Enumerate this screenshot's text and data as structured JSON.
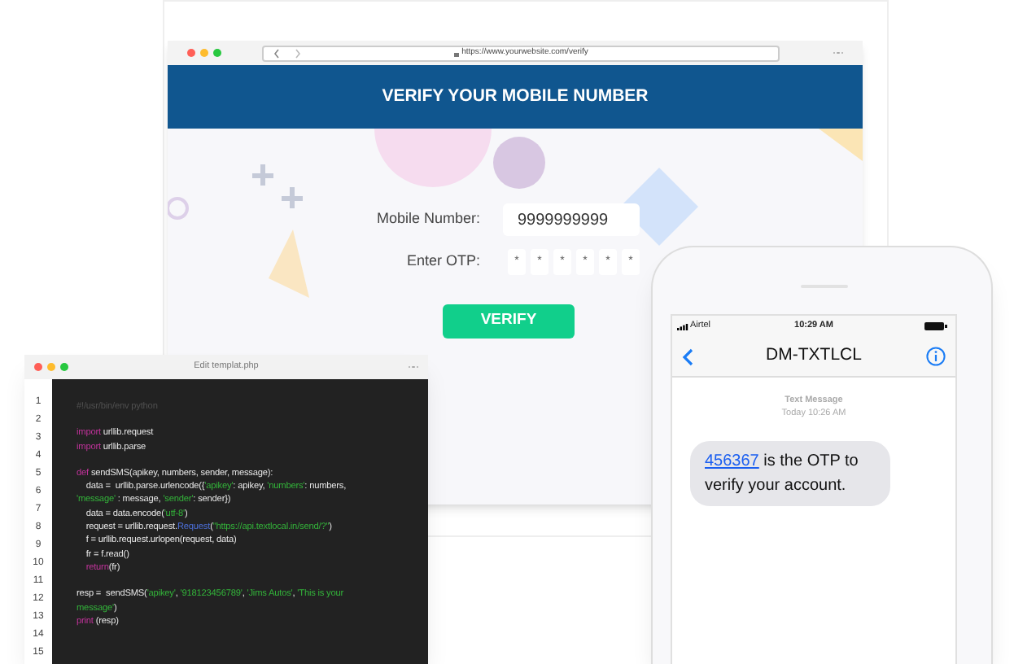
{
  "browser": {
    "url": "https://www.yourwebsite.com/verify",
    "header": "VERIFY YOUR MOBILE NUMBER",
    "form": {
      "mobile_label": "Mobile Number:",
      "mobile_value": "9999999999",
      "otp_label": "Enter OTP:",
      "otp_digits": [
        "*",
        "*",
        "*",
        "*",
        "*",
        "*"
      ],
      "button": "VERIFY"
    }
  },
  "editor": {
    "title": "Edit templat.php",
    "line_numbers": [
      "1",
      "2",
      "3",
      "4",
      "5",
      "6",
      "7",
      "8",
      "9",
      "10",
      "11",
      "12",
      "13",
      "14",
      "15"
    ],
    "code_blocks": [
      [
        [
          {
            "kind": "comment",
            "text": "#!/usr/bin/env python"
          }
        ]
      ],
      [
        [
          {
            "kind": "keyword",
            "text": "import"
          },
          {
            "kind": "plain",
            "text": " urllib.request"
          }
        ],
        [
          {
            "kind": "keyword",
            "text": "import"
          },
          {
            "kind": "plain",
            "text": " urllib.parse"
          }
        ]
      ],
      [
        [
          {
            "kind": "keyword",
            "text": "def"
          },
          {
            "kind": "plain",
            "text": " sendSMS(apikey, numbers, sender, message):"
          }
        ],
        [
          {
            "kind": "plain",
            "text": "    data =  urllib.parse.urlencode({"
          },
          {
            "kind": "string",
            "text": "'apikey'"
          },
          {
            "kind": "plain",
            "text": ": apikey, "
          },
          {
            "kind": "string",
            "text": "'numbers'"
          },
          {
            "kind": "plain",
            "text": ": numbers,"
          }
        ],
        [
          {
            "kind": "string",
            "text": "'message'"
          },
          {
            "kind": "plain",
            "text": " : message, "
          },
          {
            "kind": "string",
            "text": "'sender'"
          },
          {
            "kind": "plain",
            "text": ": sender})"
          }
        ],
        [
          {
            "kind": "plain",
            "text": "    data = data.encode("
          },
          {
            "kind": "string",
            "text": "'utf-8'"
          },
          {
            "kind": "plain",
            "text": ")"
          }
        ],
        [
          {
            "kind": "plain",
            "text": "    request = urllib.request."
          },
          {
            "kind": "class",
            "text": "Request"
          },
          {
            "kind": "plain",
            "text": "("
          },
          {
            "kind": "string",
            "text": "\"https://api.textlocal.in/send/?\""
          },
          {
            "kind": "plain",
            "text": ")"
          }
        ],
        [
          {
            "kind": "plain",
            "text": "    f = urllib.request.urlopen(request, data)"
          }
        ],
        [
          {
            "kind": "plain",
            "text": "    fr = f.read()"
          }
        ],
        [
          {
            "kind": "keyword",
            "text": "    return"
          },
          {
            "kind": "plain",
            "text": "(fr)"
          }
        ]
      ],
      [
        [
          {
            "kind": "plain",
            "text": "resp =  sendSMS("
          },
          {
            "kind": "string",
            "text": "'apikey'"
          },
          {
            "kind": "plain",
            "text": ", "
          },
          {
            "kind": "string",
            "text": "'918123456789'"
          },
          {
            "kind": "plain",
            "text": ", "
          },
          {
            "kind": "string",
            "text": "'Jims Autos'"
          },
          {
            "kind": "plain",
            "text": ", "
          },
          {
            "kind": "string",
            "text": "'This is your"
          }
        ],
        [
          {
            "kind": "string",
            "text": "message'"
          },
          {
            "kind": "plain",
            "text": ")"
          }
        ],
        [
          {
            "kind": "keyword",
            "text": "print"
          },
          {
            "kind": "plain",
            "text": " (resp)"
          }
        ]
      ]
    ]
  },
  "phone": {
    "carrier": "Airtel",
    "time": "10:29 AM",
    "contact": "DM-TXTLCL",
    "thread_label": "Text Message",
    "thread_time": "Today 10:26 AM",
    "message": {
      "link": "456367",
      "text": "is the OTP to verify your account."
    }
  }
}
